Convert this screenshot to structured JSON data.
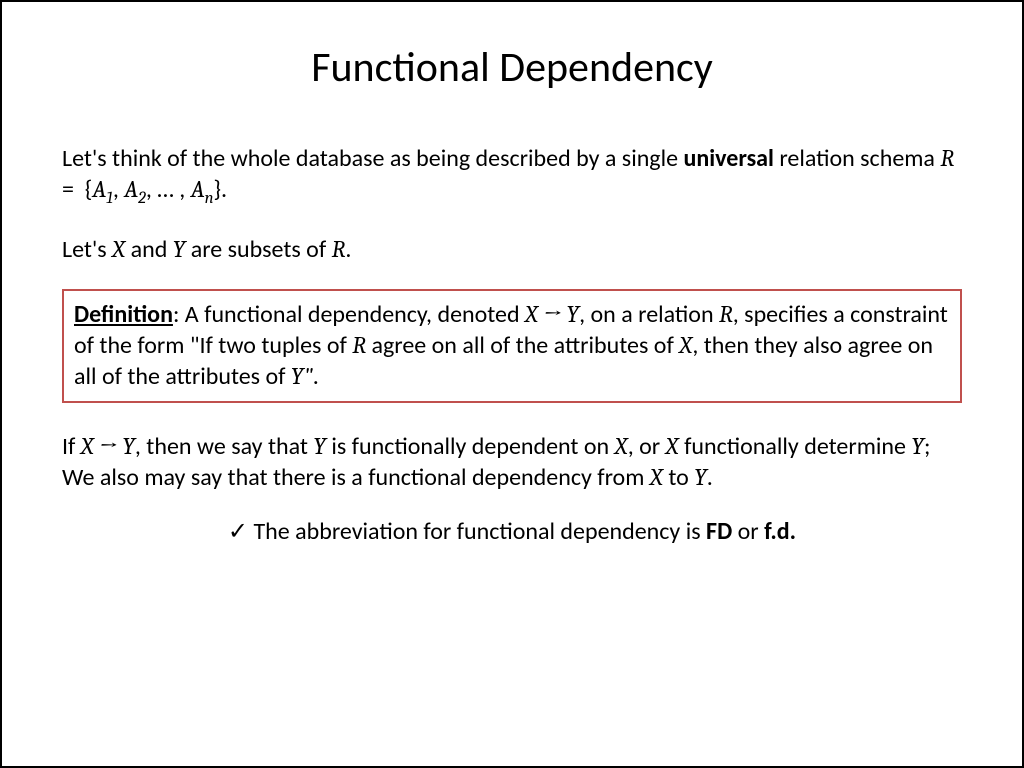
{
  "title": "Functional Dependency",
  "para1_part1": "Let's think of the whole database as being described by a single ",
  "para1_bold": "universal",
  "para1_part2": " relation schema ",
  "para1_math": "R =  {A₁, A₂, … , Aₙ}.",
  "para2_part1": "Let's ",
  "para2_X": "X",
  "para2_part2": " and ",
  "para2_Y": "Y",
  "para2_part3": " are subsets of ",
  "para2_R": "R",
  "para2_end": ".",
  "def_label": "Definition",
  "def_part1": ": A functional dependency, denoted ",
  "def_XY": "X → Y",
  "def_part2": ", on a relation ",
  "def_R": "R",
  "def_part3": ", specifies a constraint of the form \"If two tuples of ",
  "def_R2": "R",
  "def_part4": " agree on all of the attributes of ",
  "def_X": "X",
  "def_part5": ", then they also agree on all of the attributes of ",
  "def_Y": "Y\"",
  "def_end": ".",
  "para3_part1": "If ",
  "para3_XY": "X → Y",
  "para3_part2": ", then we say that ",
  "para3_Y": "Y",
  "para3_part3": " is functionally dependent on ",
  "para3_X": "X",
  "para3_part4": ", or ",
  "para3_X2": "X",
  "para3_part5": " functionally determine ",
  "para3_Y2": "Y",
  "para3_part6": "; We also may say that there is a functional dependency from ",
  "para3_X3": "X",
  "para3_part7": " to ",
  "para3_Y3": "Y",
  "para3_end": ".",
  "check": "✓",
  "abbrev_part1": " The abbreviation for functional dependency is ",
  "abbrev_FD": "FD",
  "abbrev_or": " or ",
  "abbrev_fd": "f.d."
}
